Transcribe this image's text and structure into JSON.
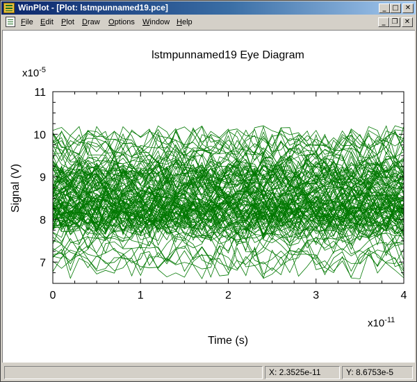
{
  "window": {
    "title": "WinPlot - [Plot: lstmpunnamed19.pce]",
    "min_glyph": "_",
    "max_glyph": "□",
    "close_glyph": "✕",
    "restore_glyph": "❐"
  },
  "menu": {
    "items": [
      "File",
      "Edit",
      "Plot",
      "Draw",
      "Options",
      "Window",
      "Help"
    ]
  },
  "status": {
    "x_readout": "X: 2.3525e-11",
    "y_readout": "Y: 8.6753e-5"
  },
  "colors": {
    "trace": "#007800",
    "titlebar": "#0a246a"
  },
  "chart_data": {
    "type": "line",
    "title": "lstmpunnamed19 Eye Diagram",
    "xlabel": "Time (s)",
    "ylabel": "Signal (V)",
    "x_multiplier": "x10",
    "x_exponent": "-11",
    "y_multiplier": "x10",
    "y_exponent": "-5",
    "xlim": [
      0,
      4
    ],
    "ylim": [
      6.5,
      11
    ],
    "x_ticks": [
      "0",
      "1",
      "2",
      "3",
      "4"
    ],
    "y_ticks": [
      "7",
      "8",
      "9",
      "10",
      "11"
    ],
    "x_tick_values": [
      0,
      1,
      2,
      3,
      4
    ],
    "y_tick_values": [
      7,
      8,
      9,
      10,
      11
    ],
    "grid": false,
    "legend": "none",
    "series_count": 120,
    "samples_per_trace": 41,
    "signal_mean": 8.5,
    "signal_min": 6.5,
    "signal_max": 10.2
  }
}
